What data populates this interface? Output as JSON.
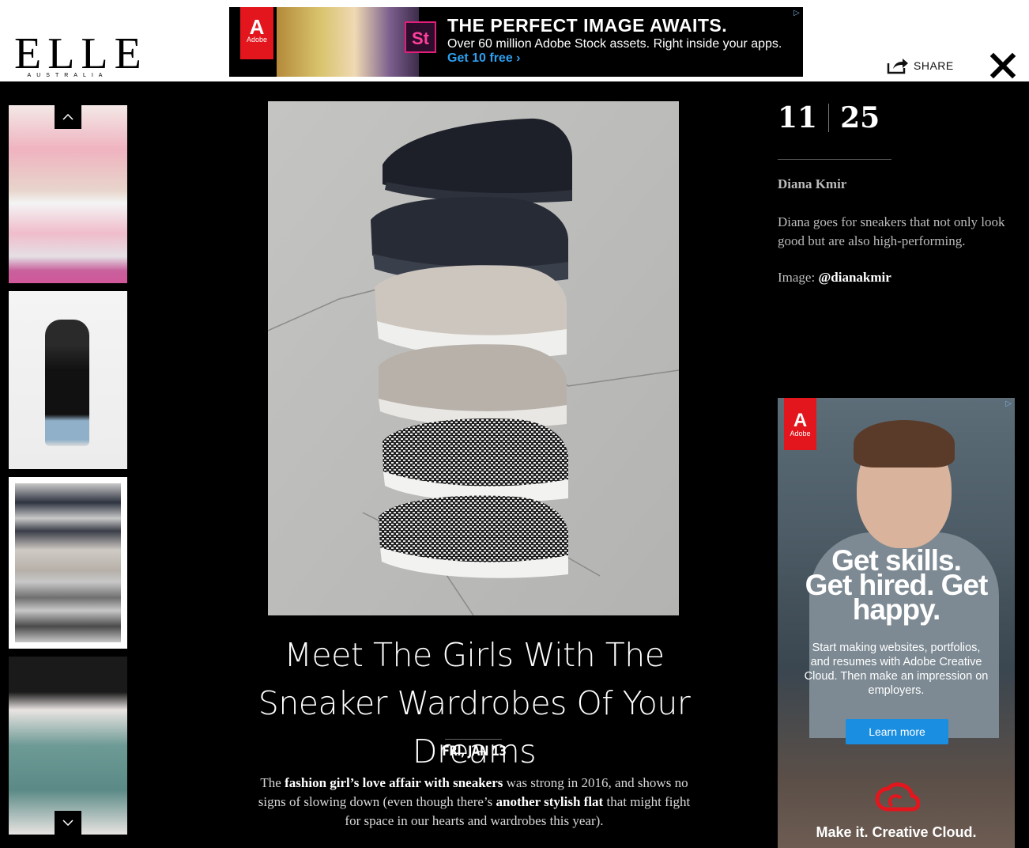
{
  "header": {
    "logo": "ELLE",
    "logo_sub": "AUSTRALIA",
    "share_label": "SHARE"
  },
  "top_ad": {
    "brand": "Adobe",
    "product_badge": "St",
    "headline": "THE PERFECT IMAGE AWAITS.",
    "subline": "Over 60 million Adobe Stock assets. Right inside your apps.",
    "cta": "Get 10 free ›"
  },
  "gallery": {
    "current": "11",
    "total": "25",
    "title": "Meet The Girls With The Sneaker Wardrobes Of Your Dreams",
    "date": "FRI, JAN 13",
    "intro_part1": "The ",
    "intro_bold1": "fashion girl’s love affair with sneakers",
    "intro_part2": " was strong in 2016, and shows no signs of slowing down (even though there’s ",
    "intro_bold2": "another stylish flat",
    "intro_part3": " that might fight for space in our hearts and wardrobes this year).",
    "credit_name": "Diana Kmir",
    "caption": "Diana goes for sneakers that not only look good but are also high-performing.",
    "image_label": "Image: ",
    "image_handle": "@dianakmir"
  },
  "side_ad": {
    "brand": "Adobe",
    "headline_line1": "Get skills.",
    "headline_line2": "Get hired. Get",
    "headline_line3": "happy.",
    "body": "Start making websites, portfolios, and resumes with Adobe Creative Cloud. Then make an impression on employers.",
    "button": "Learn more",
    "footer": "Make it. Creative Cloud."
  },
  "colors": {
    "background": "#000000",
    "adobe_red": "#e3161d",
    "ad_blue": "#1a8ee0"
  }
}
